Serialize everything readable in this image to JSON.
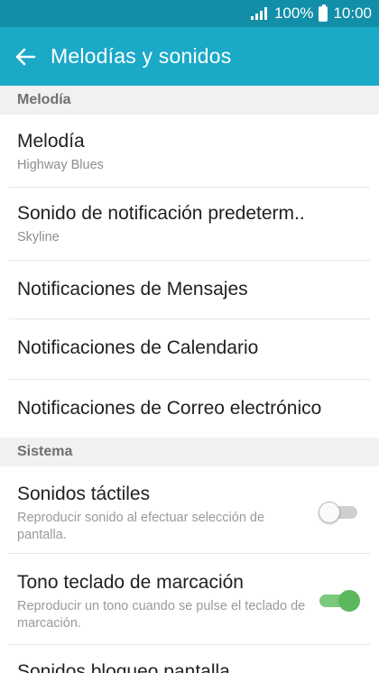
{
  "status_bar": {
    "battery_text": "100%",
    "time": "10:00"
  },
  "app_bar": {
    "title": "Melodías y sonidos"
  },
  "sections": {
    "melodia": {
      "header": "Melodía",
      "items": [
        {
          "title": "Melodía",
          "subtitle": "Highway Blues"
        },
        {
          "title": "Sonido de notificación predeterm..",
          "subtitle": "Skyline"
        },
        {
          "title": "Notificaciones de Mensajes"
        },
        {
          "title": "Notificaciones de Calendario"
        },
        {
          "title": "Notificaciones de Correo electrónico"
        }
      ]
    },
    "sistema": {
      "header": "Sistema",
      "items": [
        {
          "title": "Sonidos táctiles",
          "description": "Reproducir sonido al efectuar selección de pantalla.",
          "enabled": false
        },
        {
          "title": "Tono teclado de marcación",
          "description": "Reproducir un tono cuando se pulse el teclado de marcación.",
          "enabled": true
        },
        {
          "title": "Sonidos bloqueo pantalla"
        }
      ]
    }
  },
  "colors": {
    "status_bar": "#138ea8",
    "app_bar": "#1ba9c8",
    "toggle_on": "#5cb85c",
    "toggle_off": "#cfcfcf"
  }
}
